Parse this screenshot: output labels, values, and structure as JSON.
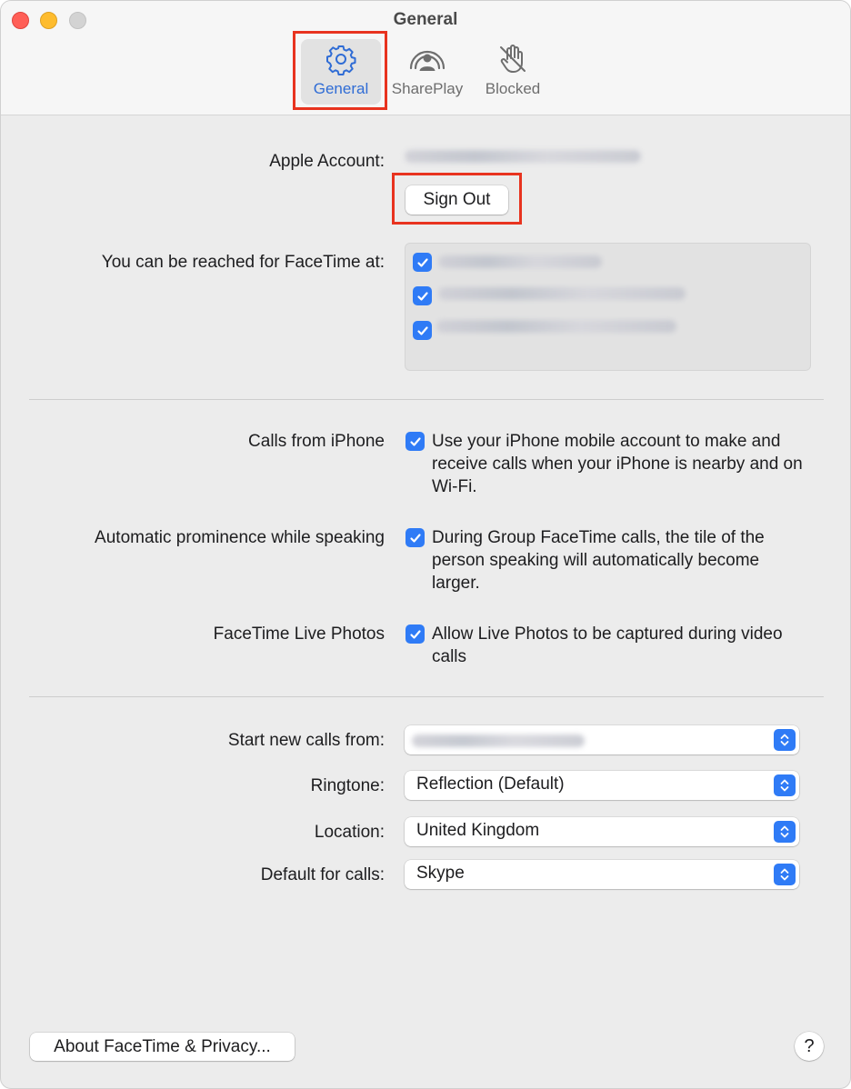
{
  "window": {
    "title": "General"
  },
  "tabs": [
    {
      "label": "General",
      "icon": "gear-icon",
      "selected": true
    },
    {
      "label": "SharePlay",
      "icon": "shareplay-icon",
      "selected": false
    },
    {
      "label": "Blocked",
      "icon": "blocked-hand-icon",
      "selected": false
    }
  ],
  "account": {
    "label": "Apple Account:",
    "sign_out_label": "Sign Out"
  },
  "reachable": {
    "label": "You can be reached for FaceTime at:",
    "addresses": [
      {
        "checked": true
      },
      {
        "checked": true
      },
      {
        "checked": true
      }
    ]
  },
  "options": [
    {
      "label": "Calls from iPhone",
      "checked": true,
      "description": "Use your iPhone mobile account to make and receive calls when your iPhone is nearby and on Wi-Fi."
    },
    {
      "label": "Automatic prominence while speaking",
      "checked": true,
      "description": "During Group FaceTime calls, the tile of the person speaking will automatically become larger."
    },
    {
      "label": "FaceTime Live Photos",
      "checked": true,
      "description": "Allow Live Photos to be captured during video calls"
    }
  ],
  "settings": [
    {
      "label": "Start new calls from:",
      "value": ""
    },
    {
      "label": "Ringtone:",
      "value": "Reflection (Default)"
    },
    {
      "label": "Location:",
      "value": "United Kingdom"
    },
    {
      "label": "Default for calls:",
      "value": "Skype"
    }
  ],
  "footer": {
    "about_label": "About FaceTime & Privacy...",
    "help_label": "?"
  },
  "colors": {
    "accent": "#2f7bf6",
    "selected_tab_text": "#2f6cd5",
    "highlight_box": "#e8331f"
  }
}
